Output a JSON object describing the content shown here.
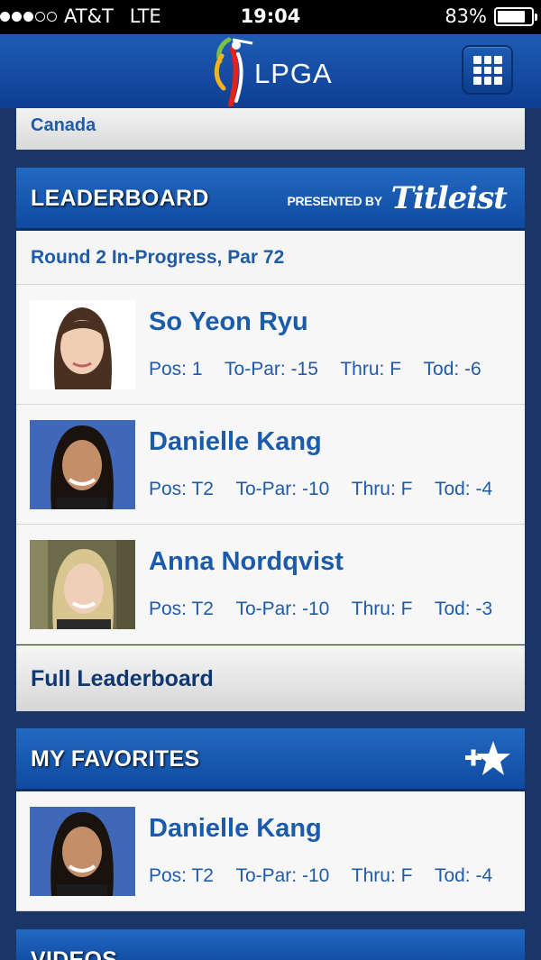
{
  "status_bar": {
    "carrier": "AT&T",
    "network": "LTE",
    "time": "19:04",
    "battery": "83%",
    "battery_level": 0.83,
    "signal_bars_filled": 3,
    "signal_bars_total": 5
  },
  "app_header": {
    "logo_text": "LPGA",
    "menu_icon": "grid-icon"
  },
  "top_card": {
    "label": "Canada"
  },
  "leaderboard": {
    "title": "LEADERBOARD",
    "presented_by": "PRESENTED BY",
    "sponsor": "Titleist",
    "round_info": "Round 2 In-Progress, Par 72",
    "players": [
      {
        "name": "So Yeon Ryu",
        "pos": "Pos: 1",
        "to_par": "To-Par: -15",
        "thru": "Thru: F",
        "today": "Tod: -6"
      },
      {
        "name": "Danielle Kang",
        "pos": "Pos: T2",
        "to_par": "To-Par: -10",
        "thru": "Thru: F",
        "today": "Tod: -4"
      },
      {
        "name": "Anna Nordqvist",
        "pos": "Pos: T2",
        "to_par": "To-Par: -10",
        "thru": "Thru: F",
        "today": "Tod: -3"
      }
    ],
    "full_link": "Full Leaderboard"
  },
  "favorites": {
    "title": "MY FAVORITES",
    "add_icon": "add-favorite-star-icon",
    "players": [
      {
        "name": "Danielle Kang",
        "pos": "Pos: T2",
        "to_par": "To-Par: -10",
        "thru": "Thru: F",
        "today": "Tod: -4"
      }
    ]
  },
  "videos": {
    "title": "VIDEOS"
  },
  "colors": {
    "accent_blue": "#1f5ba8",
    "header_blue": "#1a55ad",
    "page_background": "#1a3666"
  }
}
